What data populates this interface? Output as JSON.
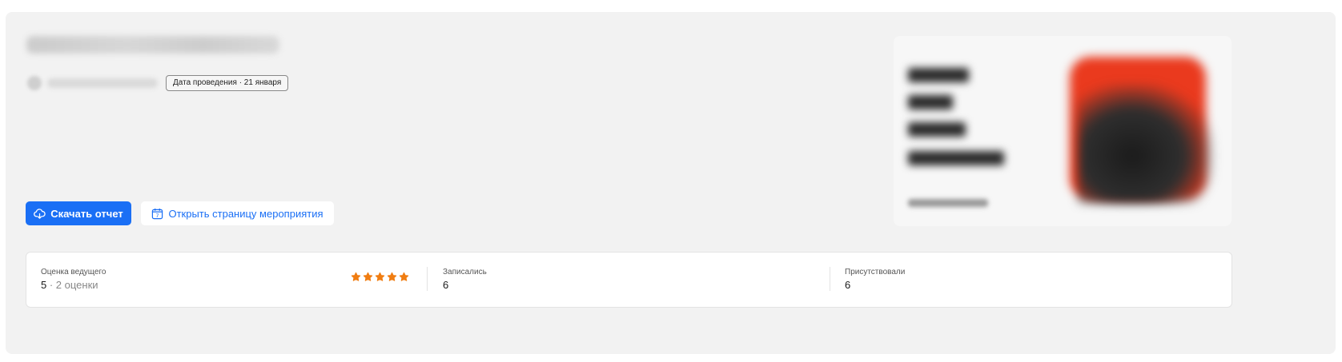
{
  "event": {
    "title": "",
    "date_badge": "Дата проведения · 21 января"
  },
  "actions": {
    "download_label": "Скачать отчет",
    "open_page_label": "Открыть страницу мероприятия",
    "calendar_icon_day": "7"
  },
  "stats": {
    "rating": {
      "label": "Оценка ведущего",
      "value": "5",
      "count_text": "· 2 оценки",
      "stars": 5,
      "star_color": "#f07d12"
    },
    "registered": {
      "label": "Записались",
      "value": "6"
    },
    "attended": {
      "label": "Присутствовали",
      "value": "6"
    }
  },
  "colors": {
    "accent": "#1a6ff5",
    "card_bg": "#f2f2f2",
    "banner_red": "#ea3a1e"
  },
  "icons": {
    "download": "cloud-download-icon",
    "calendar": "calendar-icon",
    "star": "star-icon"
  }
}
